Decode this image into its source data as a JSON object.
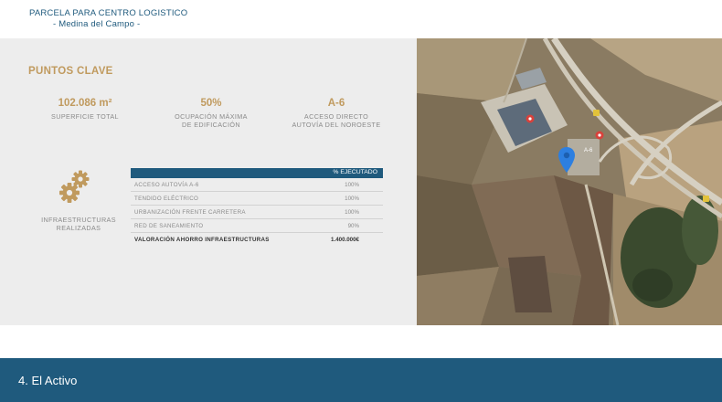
{
  "header": {
    "title": "PARCELA PARA CENTRO LOGISTICO",
    "subtitle": "- Medina del Campo -"
  },
  "section_title": "PUNTOS CLAVE",
  "kpis": [
    {
      "value": "102.086 m²",
      "label_line1": "SUPERFICIE TOTAL",
      "label_line2": ""
    },
    {
      "value": "50%",
      "label_line1": "OCUPACIÓN MÁXIMA",
      "label_line2": "DE EDIFICACIÓN"
    },
    {
      "value": "A-6",
      "label_line1": "ACCESO DIRECTO",
      "label_line2": "AUTOVÍA DEL NOROESTE"
    }
  ],
  "infra": {
    "label_line1": "INFRAESTRUCTURAS",
    "label_line2": "REALIZADAS",
    "icon": "gears-icon"
  },
  "table": {
    "header": "% EJECUTADO",
    "rows": [
      {
        "item": "ACCESO AUTOVÍA A-6",
        "value": "100%"
      },
      {
        "item": "TENDIDO ELÉCTRICO",
        "value": "100%"
      },
      {
        "item": "URBANIZACIÓN FRENTE CARRETERA",
        "value": "100%"
      },
      {
        "item": "RED DE SANEAMIENTO",
        "value": "90%"
      }
    ],
    "total": {
      "item": "VALORACIÓN AHORRO INFRAESTRUCTURAS",
      "value": "1.400.000€"
    }
  },
  "map": {
    "marker_icon": "location-pin-icon",
    "marker_color": "#2d7fe0",
    "road_label": "A-6"
  },
  "footer": {
    "text": "4. El Activo"
  },
  "colors": {
    "brand_blue": "#1f5a7d",
    "gold": "#c09a5e",
    "panel_gray": "#ededed"
  }
}
